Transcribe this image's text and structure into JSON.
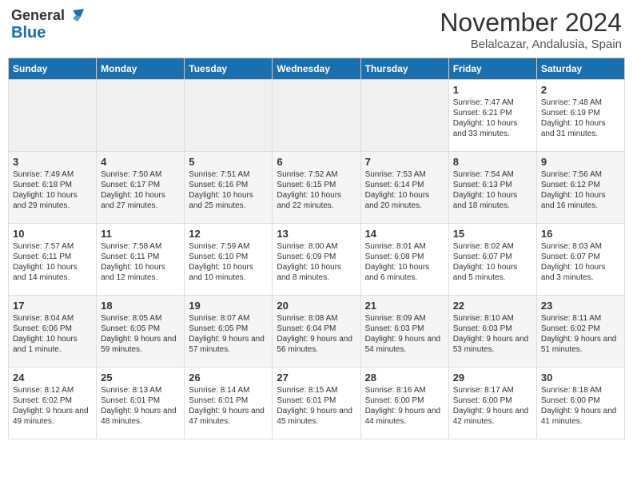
{
  "header": {
    "logo_general": "General",
    "logo_blue": "Blue",
    "month_title": "November 2024",
    "location": "Belalcazar, Andalusia, Spain"
  },
  "weekdays": [
    "Sunday",
    "Monday",
    "Tuesday",
    "Wednesday",
    "Thursday",
    "Friday",
    "Saturday"
  ],
  "weeks": [
    [
      {
        "day": "",
        "info": ""
      },
      {
        "day": "",
        "info": ""
      },
      {
        "day": "",
        "info": ""
      },
      {
        "day": "",
        "info": ""
      },
      {
        "day": "",
        "info": ""
      },
      {
        "day": "1",
        "info": "Sunrise: 7:47 AM\nSunset: 6:21 PM\nDaylight: 10 hours and 33 minutes."
      },
      {
        "day": "2",
        "info": "Sunrise: 7:48 AM\nSunset: 6:19 PM\nDaylight: 10 hours and 31 minutes."
      }
    ],
    [
      {
        "day": "3",
        "info": "Sunrise: 7:49 AM\nSunset: 6:18 PM\nDaylight: 10 hours and 29 minutes."
      },
      {
        "day": "4",
        "info": "Sunrise: 7:50 AM\nSunset: 6:17 PM\nDaylight: 10 hours and 27 minutes."
      },
      {
        "day": "5",
        "info": "Sunrise: 7:51 AM\nSunset: 6:16 PM\nDaylight: 10 hours and 25 minutes."
      },
      {
        "day": "6",
        "info": "Sunrise: 7:52 AM\nSunset: 6:15 PM\nDaylight: 10 hours and 22 minutes."
      },
      {
        "day": "7",
        "info": "Sunrise: 7:53 AM\nSunset: 6:14 PM\nDaylight: 10 hours and 20 minutes."
      },
      {
        "day": "8",
        "info": "Sunrise: 7:54 AM\nSunset: 6:13 PM\nDaylight: 10 hours and 18 minutes."
      },
      {
        "day": "9",
        "info": "Sunrise: 7:56 AM\nSunset: 6:12 PM\nDaylight: 10 hours and 16 minutes."
      }
    ],
    [
      {
        "day": "10",
        "info": "Sunrise: 7:57 AM\nSunset: 6:11 PM\nDaylight: 10 hours and 14 minutes."
      },
      {
        "day": "11",
        "info": "Sunrise: 7:58 AM\nSunset: 6:11 PM\nDaylight: 10 hours and 12 minutes."
      },
      {
        "day": "12",
        "info": "Sunrise: 7:59 AM\nSunset: 6:10 PM\nDaylight: 10 hours and 10 minutes."
      },
      {
        "day": "13",
        "info": "Sunrise: 8:00 AM\nSunset: 6:09 PM\nDaylight: 10 hours and 8 minutes."
      },
      {
        "day": "14",
        "info": "Sunrise: 8:01 AM\nSunset: 6:08 PM\nDaylight: 10 hours and 6 minutes."
      },
      {
        "day": "15",
        "info": "Sunrise: 8:02 AM\nSunset: 6:07 PM\nDaylight: 10 hours and 5 minutes."
      },
      {
        "day": "16",
        "info": "Sunrise: 8:03 AM\nSunset: 6:07 PM\nDaylight: 10 hours and 3 minutes."
      }
    ],
    [
      {
        "day": "17",
        "info": "Sunrise: 8:04 AM\nSunset: 6:06 PM\nDaylight: 10 hours and 1 minute."
      },
      {
        "day": "18",
        "info": "Sunrise: 8:05 AM\nSunset: 6:05 PM\nDaylight: 9 hours and 59 minutes."
      },
      {
        "day": "19",
        "info": "Sunrise: 8:07 AM\nSunset: 6:05 PM\nDaylight: 9 hours and 57 minutes."
      },
      {
        "day": "20",
        "info": "Sunrise: 8:08 AM\nSunset: 6:04 PM\nDaylight: 9 hours and 56 minutes."
      },
      {
        "day": "21",
        "info": "Sunrise: 8:09 AM\nSunset: 6:03 PM\nDaylight: 9 hours and 54 minutes."
      },
      {
        "day": "22",
        "info": "Sunrise: 8:10 AM\nSunset: 6:03 PM\nDaylight: 9 hours and 53 minutes."
      },
      {
        "day": "23",
        "info": "Sunrise: 8:11 AM\nSunset: 6:02 PM\nDaylight: 9 hours and 51 minutes."
      }
    ],
    [
      {
        "day": "24",
        "info": "Sunrise: 8:12 AM\nSunset: 6:02 PM\nDaylight: 9 hours and 49 minutes."
      },
      {
        "day": "25",
        "info": "Sunrise: 8:13 AM\nSunset: 6:01 PM\nDaylight: 9 hours and 48 minutes."
      },
      {
        "day": "26",
        "info": "Sunrise: 8:14 AM\nSunset: 6:01 PM\nDaylight: 9 hours and 47 minutes."
      },
      {
        "day": "27",
        "info": "Sunrise: 8:15 AM\nSunset: 6:01 PM\nDaylight: 9 hours and 45 minutes."
      },
      {
        "day": "28",
        "info": "Sunrise: 8:16 AM\nSunset: 6:00 PM\nDaylight: 9 hours and 44 minutes."
      },
      {
        "day": "29",
        "info": "Sunrise: 8:17 AM\nSunset: 6:00 PM\nDaylight: 9 hours and 42 minutes."
      },
      {
        "day": "30",
        "info": "Sunrise: 8:18 AM\nSunset: 6:00 PM\nDaylight: 9 hours and 41 minutes."
      }
    ]
  ]
}
